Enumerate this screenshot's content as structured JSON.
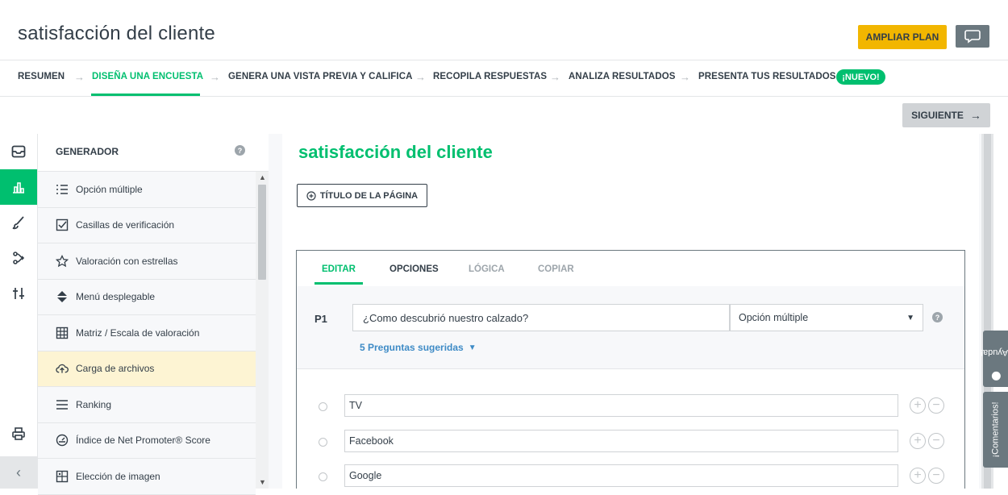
{
  "header": {
    "survey_title": "satisfacción del cliente",
    "upgrade_label": "AMPLIAR PLAN"
  },
  "steps": [
    {
      "label": "RESUMEN"
    },
    {
      "label": "DISEÑA UNA ENCUESTA"
    },
    {
      "label": "GENERA UNA VISTA PREVIA Y CALIFICA"
    },
    {
      "label": "RECOPILA RESPUESTAS"
    },
    {
      "label": "ANALIZA RESULTADOS"
    },
    {
      "label": "PRESENTA TUS RESULTADOS"
    }
  ],
  "new_badge": "¡NUEVO!",
  "next_label": "SIGUIENTE",
  "rail": {
    "icons": [
      "inbox-icon",
      "builder-icon",
      "paint-brush-icon",
      "logic-icon",
      "options-icon",
      "print-icon"
    ],
    "collapse_glyph": "‹"
  },
  "builder": {
    "title": "GENERADOR",
    "help": "?",
    "items": [
      {
        "label": "Opción múltiple",
        "icon": "list-icon"
      },
      {
        "label": "Casillas de verificación",
        "icon": "checkbox-icon"
      },
      {
        "label": "Valoración con estrellas",
        "icon": "star-icon"
      },
      {
        "label": "Menú desplegable",
        "icon": "dropdown-icon"
      },
      {
        "label": "Matriz / Escala de valoración",
        "icon": "matrix-icon"
      },
      {
        "label": "Carga de archivos",
        "icon": "upload-cloud-icon"
      },
      {
        "label": "Ranking",
        "icon": "ranking-icon"
      },
      {
        "label": "Índice de Net Promoter® Score",
        "icon": "gauge-icon"
      },
      {
        "label": "Elección de imagen",
        "icon": "image-icon"
      }
    ]
  },
  "page": {
    "title": "satisfacción del cliente",
    "page_title_button": "TÍTULO DE LA PÁGINA"
  },
  "question": {
    "tabs": [
      "EDITAR",
      "OPCIONES",
      "LÓGICA",
      "COPIAR"
    ],
    "number": "P1",
    "text": "¿Como descubrió nuestro calzado?",
    "type": "Opción múltiple",
    "help": "?",
    "suggested": "5 Preguntas sugeridas",
    "answers": [
      "TV",
      "Facebook",
      "Google"
    ]
  },
  "side_tabs": {
    "help": "¡Ayuda!",
    "feedback": "¡Comentarios!"
  },
  "colors": {
    "accent_green": "#00bf6f",
    "upgrade_yellow": "#f2b600",
    "link_blue": "#3e8bc6",
    "highlight_row": "#fdf4d3"
  }
}
